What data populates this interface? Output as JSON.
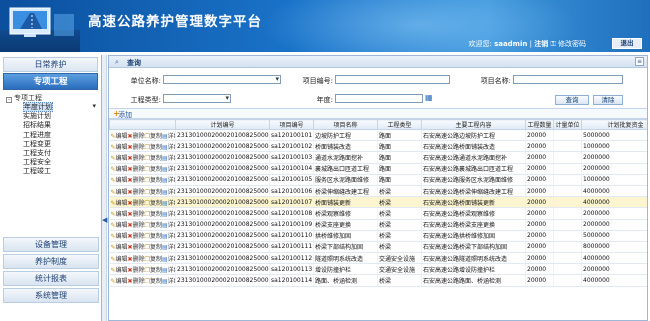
{
  "header": {
    "title": "高速公路养护管理数字平台",
    "welcome": "欢迎您:",
    "username": "saadmin",
    "logout": "注销",
    "change_password": "修改密码",
    "exit": "退出"
  },
  "sidebar": {
    "daily": "日常养护",
    "active": "专项工程",
    "tree_root": "专项工程",
    "tree_toggle": "-",
    "items": [
      "年度计划",
      "实施计划",
      "招标结果",
      "工程进度",
      "工程变更",
      "工程支付",
      "工程安全",
      "工程竣工"
    ],
    "bottom": [
      "设备管理",
      "养护制度",
      "统计报表",
      "系统管理"
    ]
  },
  "query": {
    "title": "查询",
    "unit_label": "单位名称:",
    "project_no_label": "项目编号:",
    "project_name_label": "项目名称:",
    "type_label": "工程类型:",
    "year_label": "年度:",
    "search_btn": "查询",
    "clear_btn": "清除",
    "toggle": "≡"
  },
  "toolbar": {
    "add": "添加"
  },
  "table": {
    "columns": [
      "",
      "计划编号",
      "项目编号",
      "项目名称",
      "工程类型",
      "主要工程内容",
      "工程数量",
      "计量单位",
      "计划批复资金"
    ],
    "op_labels": {
      "edit": "编辑",
      "delete": "删除",
      "copy": "复制",
      "detail": "详细"
    },
    "rows": [
      [
        "23130100020002010082500001",
        "sa120100101",
        "边坡防护工程",
        "路面",
        "石安高速公路边坡防护工程",
        "20000",
        "",
        "5000000"
      ],
      [
        "23130100020002010082500002",
        "sa120100102",
        "桥面铺装改造",
        "路面",
        "石安高速公路桥面铺装改造",
        "20000",
        "",
        "1000000"
      ],
      [
        "23130100020002010082500003",
        "sa120100103",
        "通道水泥路面挖补",
        "路面",
        "石安高速公路通道水泥路面挖补",
        "20000",
        "",
        "2000000"
      ],
      [
        "23130100020002010082500004",
        "sa120100104",
        "襄城路出口匝道工程",
        "路面",
        "石安高速公路襄城路出口匝道工程",
        "20000",
        "",
        "2000000"
      ],
      [
        "23130100020002010082500005",
        "sa120100105",
        "服务区水泥路面维修",
        "路面",
        "石安高速公路服务区水泥路面维修",
        "20000",
        "",
        "1000000"
      ],
      [
        "23130100020002010082500006",
        "sa120100106",
        "桥梁伸缩缝改建工程",
        "桥梁",
        "石安高速公路桥梁伸缩缝改建工程",
        "20000",
        "",
        "4000000"
      ],
      [
        "23130100020002010082500007",
        "sa120100107",
        "桥面铺装更新",
        "桥梁",
        "石安高速公路桥面铺装更新",
        "20000",
        "",
        "4000000"
      ],
      [
        "23130100020002010082500008",
        "sa120100108",
        "桥梁观察维修",
        "桥梁",
        "石安高速公路桥梁观察维修",
        "20000",
        "",
        "2000000"
      ],
      [
        "23130100020002010082500009",
        "sa120100109",
        "桥梁支座更换",
        "桥梁",
        "石安高速公路桥梁支座更换",
        "20000",
        "",
        "2000000"
      ],
      [
        "23130100020002010082500010",
        "sa120100110",
        "拱桥维修加固",
        "桥梁",
        "石安高速公路拱桥维修加固",
        "20000",
        "",
        "5000000"
      ],
      [
        "23130100020002010082500011",
        "sa120100111",
        "桥梁下部结构加固",
        "桥梁",
        "石安高速公路桥梁下部结构加固",
        "20000",
        "",
        "8000000"
      ],
      [
        "23130100020002010082500012",
        "sa120100112",
        "隧道照明系统改造",
        "交通安全设施",
        "石安高速公路隧道照明系统改造",
        "20000",
        "",
        "4000000"
      ],
      [
        "23130100020002010082500013",
        "sa120100113",
        "增设防撞护栏",
        "交通安全设施",
        "石安高速公路增设防撞护栏",
        "20000",
        "",
        "2000000"
      ],
      [
        "23130100020002010082500014",
        "sa120100114",
        "路面、桥涵检测",
        "桥梁",
        "石安高速公路路面、桥涵检测",
        "20000",
        "",
        "4000000"
      ]
    ]
  }
}
